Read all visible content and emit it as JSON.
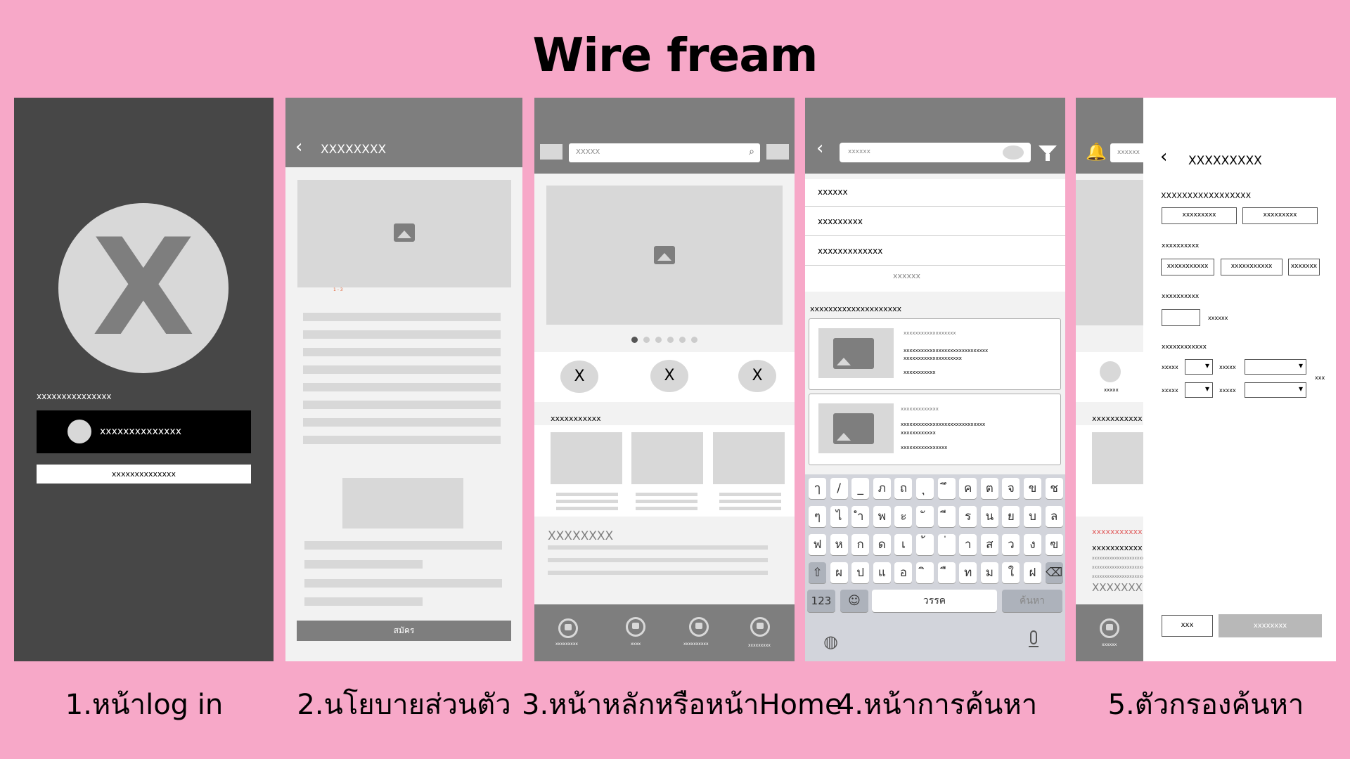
{
  "title": "Wire fream",
  "captions": [
    "1.หน้าlog in",
    "2.นโยบายส่วนตัว",
    "3.หน้าหลักหรือหน้าHome",
    "4.หน้าการค้นหา",
    "5.ตัวกรองค้นหา"
  ],
  "login": {
    "avatar_letter": "X",
    "label": "xxxxxxxxxxxxxxx",
    "button_dark": "xxxxxxxxxxxxxx",
    "button_light": "xxxxxxxxxxxxxx"
  },
  "policy": {
    "header_title": "XXXXXXXX",
    "pager": "1 - 3",
    "signup_button": "สมัคร"
  },
  "home": {
    "search_placeholder": "XXXXX",
    "circles": [
      "X",
      "X",
      "X"
    ],
    "section_label": "xxxxxxxxxxx",
    "heading": "XXXXXXXX",
    "nav_labels": [
      "xxxxxxxxx",
      "xxxx",
      "xxxxxxxxxx",
      "xxxxxxxxx"
    ]
  },
  "search": {
    "search_placeholder": "xxxxxx",
    "suggestions": [
      "xxxxxx",
      "xxxxxxxxx",
      "xxxxxxxxxxxxx"
    ],
    "more": "xxxxxx",
    "results_label": "xxxxxxxxxxxxxxxxxxxx",
    "results": [
      {
        "line1": "xxxxxxxxxxxxxxxxxx",
        "line2": "xxxxxxxxxxxxxxxxxxxxxxxxxxxxx",
        "line3": "xxxxxxxxxxxxxxxxxxxx",
        "line4": "xxxxxxxxxxx"
      },
      {
        "line1": "xxxxxxxxxxxxx",
        "line2": "xxxxxxxxxxxxxxxxxxxxxxxxxxxxx",
        "line3": "xxxxxxxxxxxx",
        "line4": "xxxxxxxxxxxxxxxx"
      }
    ],
    "keyboard_rows": [
      [
        "ๅ",
        "/",
        "_",
        "ภ",
        "ถ",
        "ุ",
        "ึ",
        "ค",
        "ต",
        "จ",
        "ข",
        "ช"
      ],
      [
        "ๆ",
        "ไ",
        "ำ",
        "พ",
        "ะ",
        "ั",
        "ี",
        "ร",
        "น",
        "ย",
        "บ",
        "ล"
      ],
      [
        "ฟ",
        "ห",
        "ก",
        "ด",
        "เ",
        "้",
        "่",
        "า",
        "ส",
        "ว",
        "ง",
        "ฃ"
      ],
      [
        "⇧",
        "ผ",
        "ป",
        "แ",
        "อ",
        "ิ",
        "ื",
        "ท",
        "ม",
        "ใ",
        "ฝ",
        "⌫"
      ]
    ],
    "key_123": "123",
    "key_space": "วรรค",
    "key_search": "ค้นหา"
  },
  "filter": {
    "back_search_placeholder": "xxxxxx",
    "back_item_label": "xxxxx",
    "back_section": "xxxxxxxxxxx",
    "back_red": "xxxxxxxxxxx",
    "back_black": "xxxxxxxxxxx",
    "back_small1": "xxxxxxxxxxxxxxxxxxxxxx",
    "back_small2": "xxxxxxxxxxxxxxxxxxxxxx",
    "back_small3": "xxxxxxxxxxxxxxxxxxxxxx",
    "back_heading": "XXXXXXX",
    "back_nav_label": "xxxxxx",
    "header_title": "XXXXXXXXX",
    "section1_label": "XXXXXXXXXXXXXXXXX",
    "section1_boxes": [
      "xxxxxxxxx",
      "xxxxxxxxx"
    ],
    "section2_label": "xxxxxxxxxx",
    "section2_boxes": [
      "xxxxxxxxxxx",
      "xxxxxxxxxxx",
      "xxxxxxx"
    ],
    "section3_label": "xxxxxxxxxx",
    "section3_extra": "xxxxxx",
    "section4_label": "xxxxxxxxxxxx",
    "field_labels": [
      "xxxxx",
      "xxxxx",
      "xxxxx",
      "xxxxx"
    ],
    "edge_label": "xxx",
    "cancel_button": "xxx",
    "apply_button": "xxxxxxxx"
  }
}
